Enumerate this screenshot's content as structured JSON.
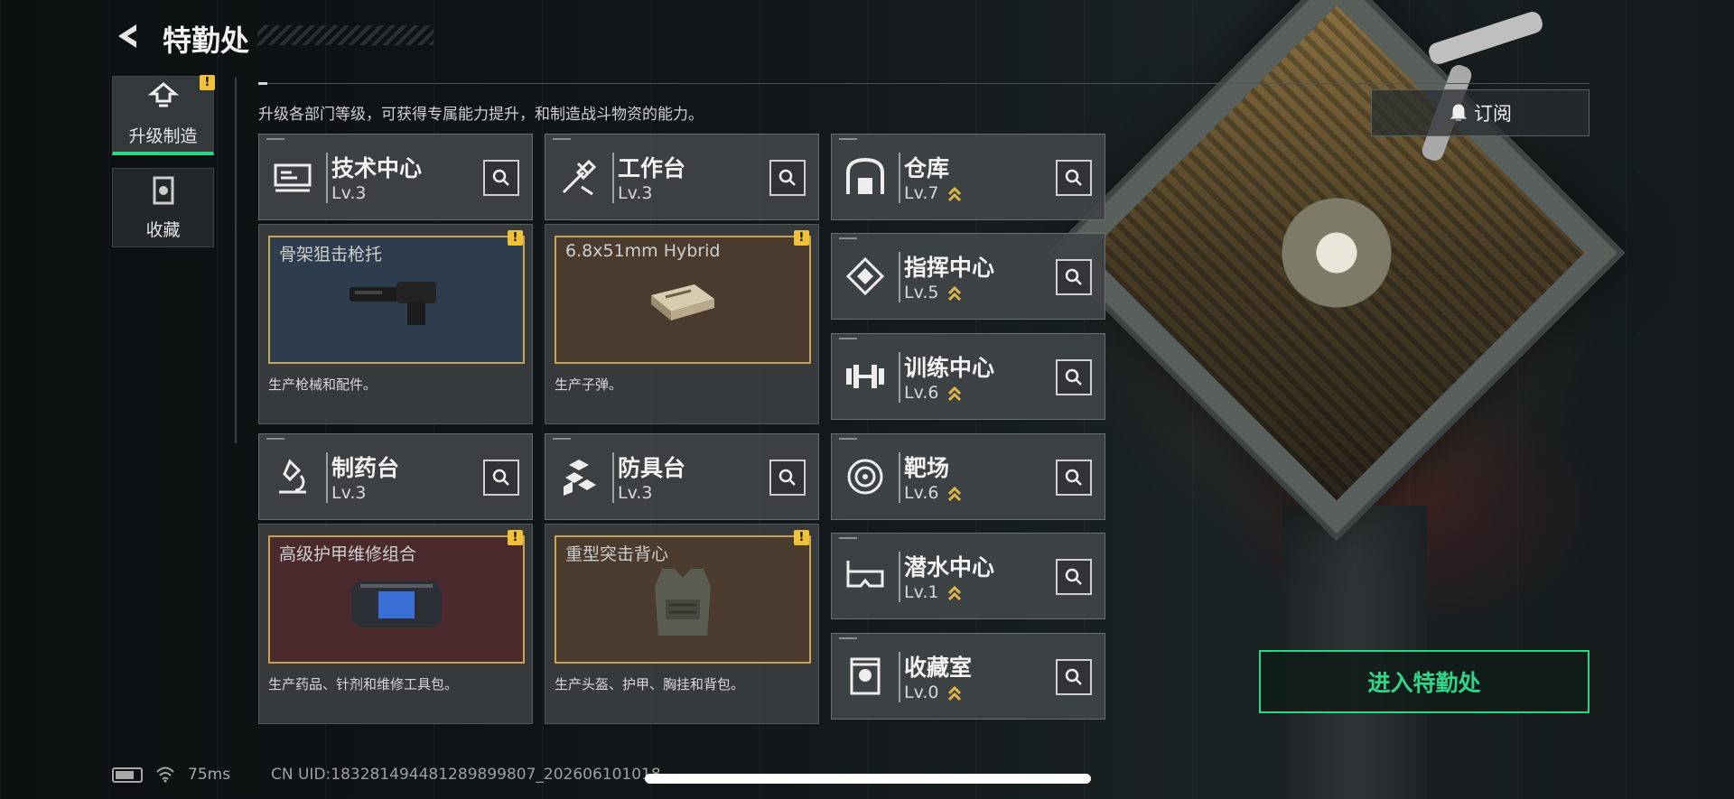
{
  "header": {
    "title": "特勤处",
    "back_icon": "back-arrow-icon"
  },
  "nav": {
    "items": [
      {
        "label": "升级制造",
        "icon": "upgrade-icon",
        "active": true,
        "alert": "!"
      },
      {
        "label": "收藏",
        "icon": "collection-icon",
        "active": false
      }
    ]
  },
  "description": "升级各部门等级，可获得专属能力提升，和制造战斗物资的能力。",
  "subscribe_label": "订阅",
  "departments": {
    "tech": {
      "name": "技术中心",
      "level": "Lv.3",
      "icon": "tech-center-icon"
    },
    "workbench": {
      "name": "工作台",
      "level": "Lv.3",
      "icon": "workbench-icon"
    },
    "pharmacy": {
      "name": "制药台",
      "level": "Lv.3",
      "icon": "pharmacy-icon"
    },
    "armor": {
      "name": "防具台",
      "level": "Lv.3",
      "icon": "armor-bench-icon"
    },
    "storage": {
      "name": "仓库",
      "level": "Lv.7",
      "icon": "warehouse-icon",
      "upgradable": true
    },
    "command": {
      "name": "指挥中心",
      "level": "Lv.5",
      "icon": "command-center-icon",
      "upgradable": true
    },
    "training": {
      "name": "训练中心",
      "level": "Lv.6",
      "icon": "training-center-icon",
      "upgradable": true
    },
    "range": {
      "name": "靶场",
      "level": "Lv.6",
      "icon": "shooting-range-icon",
      "upgradable": true
    },
    "diving": {
      "name": "潜水中心",
      "level": "Lv.1",
      "icon": "diving-center-icon",
      "upgradable": true
    },
    "vault": {
      "name": "收藏室",
      "level": "Lv.0",
      "icon": "collection-room-icon",
      "upgradable": true
    }
  },
  "productions": {
    "tech": {
      "item": "骨架狙击枪托",
      "desc": "生产枪械和配件。",
      "alert": "!"
    },
    "workbench": {
      "item": "6.8x51mm Hybrid",
      "desc": "生产子弹。",
      "alert": "!"
    },
    "pharmacy": {
      "item": "高级护甲维修组合",
      "desc": "生产药品、针剂和维修工具包。",
      "alert": "!"
    },
    "armor": {
      "item": "重型突击背心",
      "desc": "生产头盔、护甲、胸挂和背包。",
      "alert": "!"
    }
  },
  "enter_label": "进入特勤处",
  "status": {
    "ping": "75ms",
    "uid": "CN UID:18328149448128989980​7_202606101018"
  },
  "colors": {
    "accent": "#2fd58a",
    "alert": "#f0c23a",
    "frame": "#c9a34f"
  }
}
